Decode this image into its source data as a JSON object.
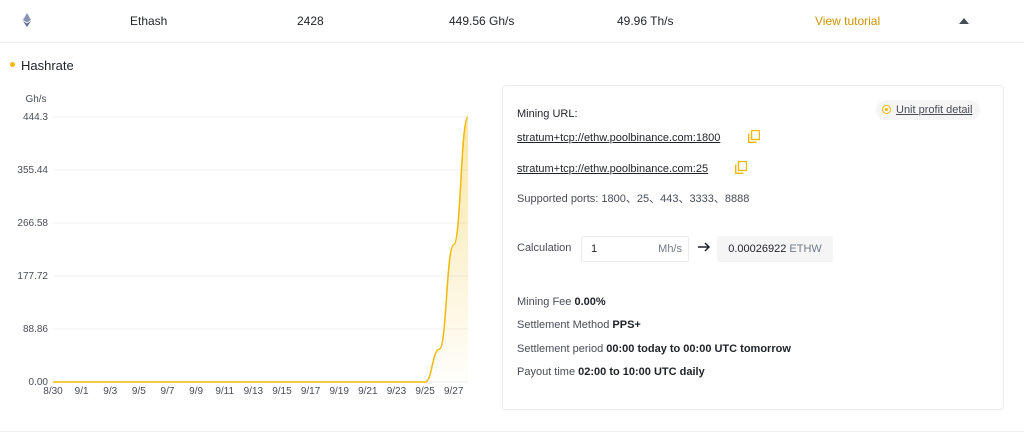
{
  "row": {
    "algorithm": "Ethash",
    "workers": "2428",
    "hashrate_a": "449.56 Gh/s",
    "hashrate_b": "49.96 Th/s",
    "tutorial_link": "View tutorial"
  },
  "section": {
    "title": "Hashrate"
  },
  "chart_data": {
    "type": "area",
    "ylabel": "Gh/s",
    "yticks": [
      "444.3",
      "355.44",
      "266.58",
      "177.72",
      "88.86",
      "0.00"
    ],
    "ylim": [
      0,
      444.3
    ],
    "xticks": [
      "8/30",
      "9/1",
      "9/3",
      "9/5",
      "9/7",
      "9/9",
      "9/11",
      "9/13",
      "9/15",
      "9/17",
      "9/19",
      "9/21",
      "9/23",
      "9/25",
      "9/27"
    ],
    "x": [
      "8/30",
      "8/31",
      "9/1",
      "9/2",
      "9/3",
      "9/4",
      "9/5",
      "9/6",
      "9/7",
      "9/8",
      "9/9",
      "9/10",
      "9/11",
      "9/12",
      "9/13",
      "9/14",
      "9/15",
      "9/16",
      "9/17",
      "9/18",
      "9/19",
      "9/20",
      "9/21",
      "9/22",
      "9/23",
      "9/24",
      "9/25",
      "9/26",
      "9/27",
      "9/28"
    ],
    "series": [
      {
        "values": [
          0,
          0,
          0,
          0,
          0,
          0,
          0,
          0,
          0,
          0,
          0,
          0,
          0,
          0,
          0,
          0,
          0,
          0,
          0,
          0,
          0,
          0,
          0,
          0,
          0,
          0,
          0,
          55,
          230,
          444.3
        ]
      }
    ],
    "grid": true,
    "color": "#f0b90b"
  },
  "mining": {
    "url_label": "Mining URL:",
    "url1": "stratum+tcp://ethw.poolbinance.com:1800",
    "url2": "stratum+tcp://ethw.poolbinance.com:25",
    "ports_label": "Supported ports: 1800、25、443、3333、8888",
    "unit_profit_label": "Unit profit detail",
    "calc_label": "Calculation",
    "calc_value": "1",
    "calc_unit": "Mh/s",
    "calc_result": "0.00026922",
    "calc_coin": "ETHW",
    "fee_label": "Mining Fee",
    "fee_value": "0.00%",
    "settlement_method_label": "Settlement Method",
    "settlement_method_value": "PPS+",
    "settlement_period_label": "Settlement period",
    "settlement_period_value": "00:00 today to 00:00 UTC tomorrow",
    "payout_label": "Payout time",
    "payout_value": "02:00 to 10:00 UTC daily"
  },
  "colors": {
    "accent": "#f0b90b",
    "link": "#c99400",
    "text": "#1e2329"
  },
  "icons": {
    "coin": "ethereum-icon",
    "copy": "copy-icon",
    "collapse": "caret-up-icon",
    "arrow": "arrow-right-icon"
  }
}
